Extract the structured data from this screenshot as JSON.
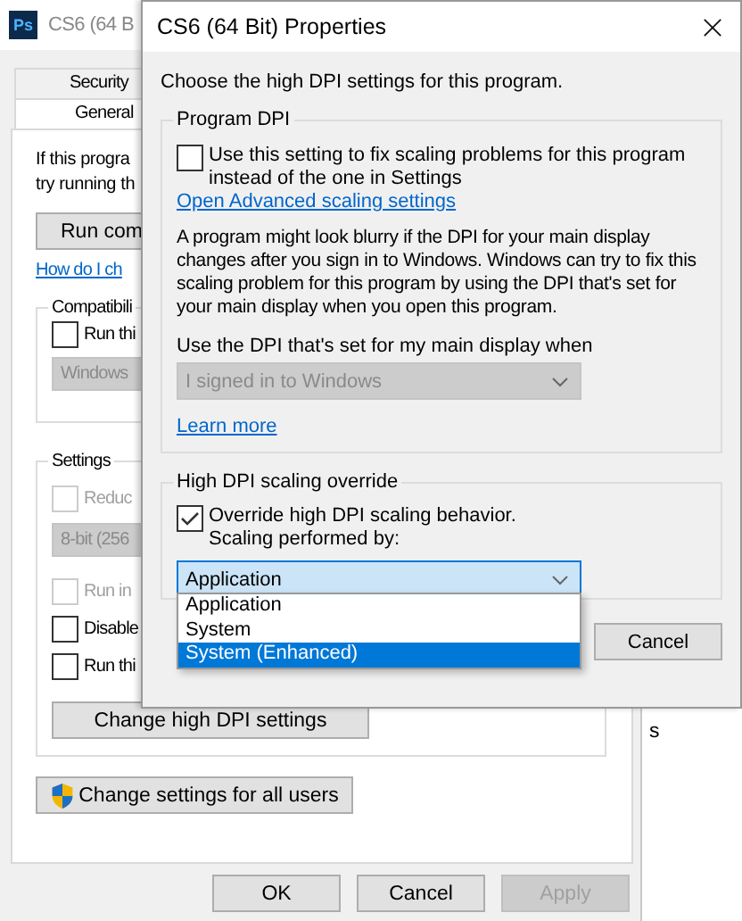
{
  "back_window": {
    "logo": "Ps",
    "title": "CS6 (64 B",
    "tabs": [
      {
        "label": "Security",
        "selected": false
      },
      {
        "label": "General",
        "selected": true
      }
    ],
    "intro_lines": [
      "If this progra",
      "try running th"
    ],
    "run_button": "Run com",
    "help_link": "How do I ch",
    "compat_group": {
      "label": "Compatibili",
      "checkbox": {
        "label": "Run thi",
        "checked": false,
        "disabled": false
      },
      "dropdown": {
        "value": "Windows",
        "disabled": true
      }
    },
    "settings_group": {
      "label": "Settings",
      "items": [
        {
          "kind": "checkbox",
          "label": "Reduc",
          "checked": false,
          "disabled": true
        },
        {
          "kind": "dropdown",
          "value": "8-bit (256",
          "disabled": true
        },
        {
          "kind": "checkbox",
          "label": "Run in",
          "checked": false,
          "disabled": true
        },
        {
          "kind": "checkbox",
          "label": "Disable",
          "checked": false,
          "disabled": false
        },
        {
          "kind": "checkbox",
          "label": "Run thi",
          "checked": false,
          "disabled": false
        }
      ],
      "button": "Change high DPI settings"
    },
    "all_users_button": "Change settings for all users",
    "buttons": [
      {
        "label": "OK",
        "disabled": false
      },
      {
        "label": "Cancel",
        "disabled": false
      },
      {
        "label": "Apply",
        "disabled": true
      }
    ]
  },
  "side_window": {
    "text": "s"
  },
  "dialog": {
    "title": "CS6 (64 Bit) Properties",
    "intro": "Choose the high DPI settings for this program.",
    "program_dpi": {
      "label": "Program DPI",
      "checkbox": {
        "lines": [
          "Use this setting to fix scaling problems for this program",
          "instead of the one in Settings"
        ],
        "checked": false
      },
      "link": "Open Advanced scaling settings",
      "paragraph": "A program might look blurry if the DPI for your main display changes after you sign in to Windows. Windows can try to fix this scaling problem for this program by using the DPI that's set for your main display when you open this program.",
      "dropdown_label": "Use the DPI that's set for my main display when",
      "dropdown": {
        "value": "I signed in to Windows",
        "disabled": true
      },
      "learn_more": "Learn more"
    },
    "override": {
      "label": "High DPI scaling override",
      "checkbox": {
        "lines": [
          "Override high DPI scaling behavior.",
          "Scaling performed by:"
        ],
        "checked": true
      },
      "dropdown": {
        "value": "Application",
        "disabled": false,
        "expanded": true,
        "options": [
          {
            "label": "Application",
            "highlighted": false
          },
          {
            "label": "System",
            "highlighted": false
          },
          {
            "label": "System (Enhanced)",
            "highlighted": true
          }
        ]
      }
    },
    "buttons": [
      {
        "label": "Cancel"
      }
    ]
  }
}
